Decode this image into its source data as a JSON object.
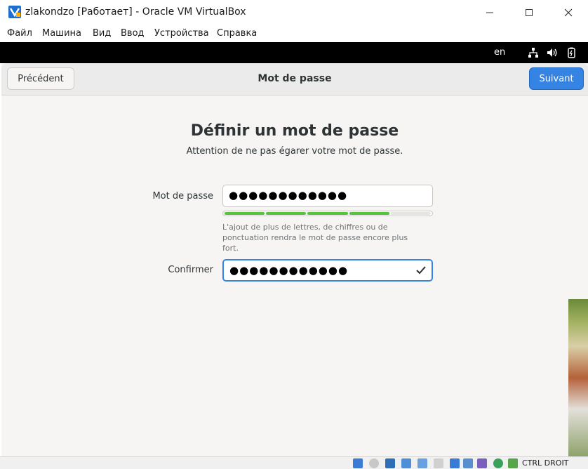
{
  "window": {
    "title": "zlakondzo [Работает] - Oracle VM VirtualBox"
  },
  "menu": [
    "Файл",
    "Машина",
    "Вид",
    "Ввод",
    "Устройства",
    "Справка"
  ],
  "guest_topbar": {
    "language": "en",
    "icons": [
      "network-icon",
      "volume-icon",
      "battery-icon"
    ]
  },
  "headerbar": {
    "prev_label": "Précédent",
    "title": "Mot de passe",
    "next_label": "Suivant"
  },
  "page": {
    "heading": "Définir un mot de passe",
    "subtitle": "Attention de ne pas égarer votre mot de passe.",
    "password_label": "Mot de passe",
    "password_value": "●●●●●●●●●●●●",
    "strength_level": 0.8,
    "hint": "L'ajout de plus de lettres, de chiffres ou de ponctuation rendra le mot de passe encore plus fort.",
    "confirm_label": "Confirmer",
    "confirm_value": "●●●●●●●●●●●●"
  },
  "statusbar": {
    "host_key": "CTRL DROIT"
  },
  "colors": {
    "accent": "#3584e4",
    "strength": "#57c43d",
    "guest_bar": "#000000"
  }
}
